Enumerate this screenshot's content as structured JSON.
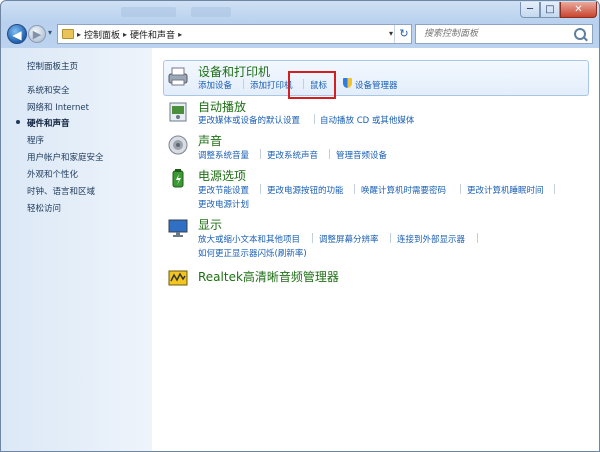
{
  "titlebar": {
    "minimize": "─",
    "maximize": "□",
    "close": "✕"
  },
  "nav": {
    "back_glyph": "◀",
    "forward_glyph": "▶",
    "recent_glyph": "▾",
    "breadcrumbs": [
      "控制面板",
      "硬件和声音"
    ],
    "refresh_glyph": "↻",
    "dropdown_glyph": "▾"
  },
  "search": {
    "placeholder": "搜索控制面板"
  },
  "sidebar": {
    "items": [
      {
        "label": "控制面板主页"
      },
      {
        "label": "系统和安全"
      },
      {
        "label": "网络和 Internet"
      },
      {
        "label": "硬件和声音"
      },
      {
        "label": "程序"
      },
      {
        "label": "用户帐户和家庭安全"
      },
      {
        "label": "外观和个性化"
      },
      {
        "label": "时钟、语言和区域"
      },
      {
        "label": "轻松访问"
      }
    ]
  },
  "categories": {
    "devices": {
      "title": "设备和打印机",
      "links": [
        "添加设备",
        "添加打印机",
        "鼠标",
        "设备管理器"
      ]
    },
    "autoplay": {
      "title": "自动播放",
      "links": [
        "更改媒体或设备的默认设置",
        "自动播放 CD 或其他媒体"
      ]
    },
    "sound": {
      "title": "声音",
      "links": [
        "调整系统音量",
        "更改系统声音",
        "管理音频设备"
      ]
    },
    "power": {
      "title": "电源选项",
      "links": [
        "更改节能设置",
        "更改电源按钮的功能",
        "唤醒计算机时需要密码",
        "更改计算机睡眠时间",
        "更改电源计划"
      ]
    },
    "display": {
      "title": "显示",
      "links": [
        "放大或缩小文本和其他项目",
        "调整屏幕分辨率",
        "连接到外部显示器",
        "如何更正显示器闪烁(刷新率)"
      ]
    },
    "realtek": {
      "title": "Realtek高清晰音频管理器"
    }
  },
  "colors": {
    "link": "#1a5fb4",
    "category_title": "#1e6e14",
    "highlight_box": "#d21f1f"
  }
}
